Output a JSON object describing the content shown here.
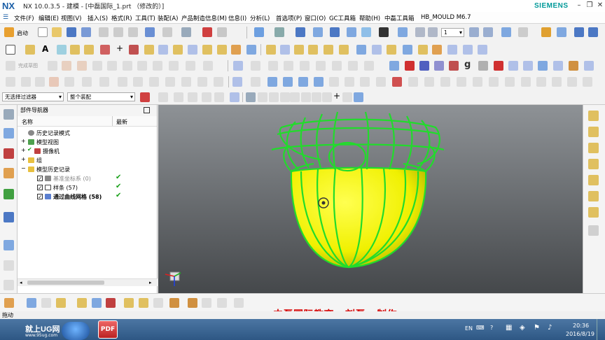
{
  "window": {
    "logo": "NX",
    "title": "NX 10.0.3.5 - 建模 - [中磊国际_1.prt （修改的）]",
    "brand": "SIEMENS"
  },
  "menu": [
    "文件(F)",
    "编辑(E)",
    "视图(V)",
    "插入(S)",
    "格式(R)",
    "工具(T)",
    "装配(A)",
    "产品制造信息(M)",
    "信息(I)",
    "分析(L)",
    "首选项(P)",
    "窗口(O)",
    "GC工具箱",
    "帮助(H)",
    "中磊工具箱",
    "HB_MOULD M6.7"
  ],
  "toolbar": {
    "start_label": "启动",
    "layer_value": "1",
    "filter_value": "无选择过滤器",
    "assembly_value": "整个装配",
    "grayed_label": "完成草图"
  },
  "navigator": {
    "title": "部件导航器",
    "col_name": "名称",
    "col_latest": "最新",
    "items": [
      {
        "label": "历史记录模式"
      },
      {
        "label": "模型视图"
      },
      {
        "label": "摄像机"
      },
      {
        "label": "组"
      },
      {
        "label": "模型历史记录"
      },
      {
        "label": "基准坐标系 (0)"
      },
      {
        "label": "样条 (57)"
      },
      {
        "label": "通过曲线网格 (58)"
      }
    ]
  },
  "caption": "中磊国际教育    刘磊    制作",
  "status": {
    "text": "拖动"
  },
  "taskbar": {
    "logo": "就上UG网",
    "logo_url": "www.95ug.com",
    "app": "PDF",
    "lang": "EN",
    "time": "20:36",
    "date": "2016/8/19"
  },
  "colors": {
    "surface": "#f0f000",
    "wire": "#21dc2b",
    "caption": "#d60000"
  }
}
